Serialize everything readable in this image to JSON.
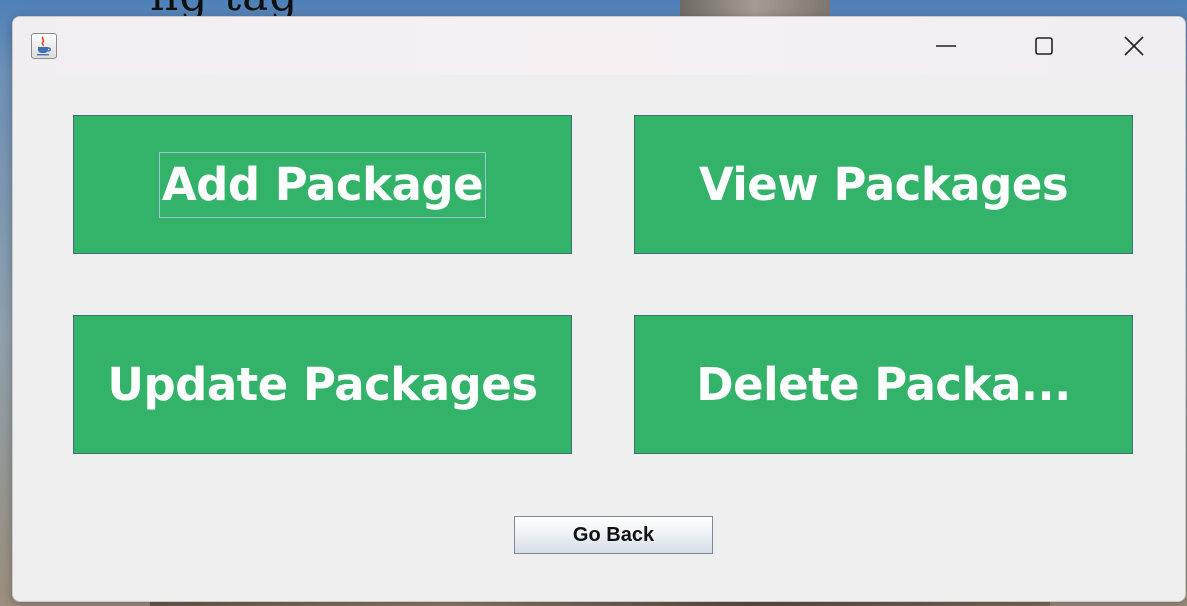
{
  "window": {
    "app_icon": "java-coffee-cup-icon",
    "controls": {
      "minimize": "minimize-icon",
      "maximize": "maximize-icon",
      "close": "close-icon"
    }
  },
  "actions": {
    "add_label": "Add Package",
    "view_label": "View Packages",
    "update_label": "Update Packages",
    "delete_label": "Delete Packa..."
  },
  "footer": {
    "go_back_label": "Go Back"
  },
  "colors": {
    "button_green": "#33b26a",
    "button_text": "#ffffff",
    "window_bg": "#efefef"
  }
}
